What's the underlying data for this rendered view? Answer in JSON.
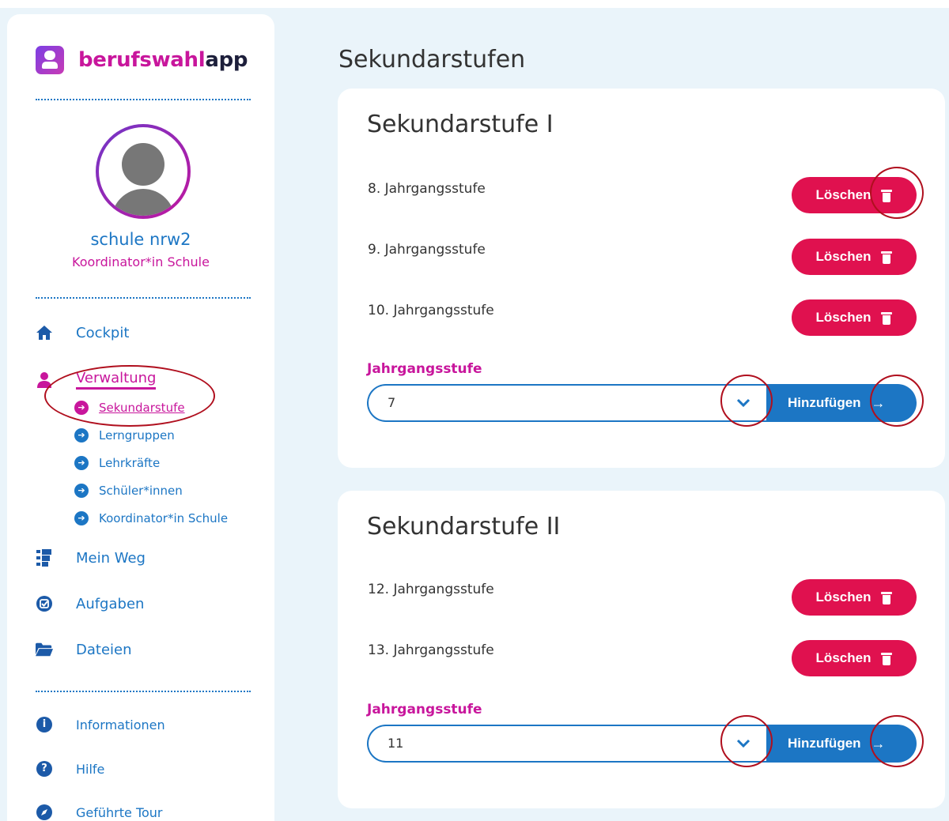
{
  "brand": {
    "name_part1": "berufswahl",
    "name_part2": "app"
  },
  "user": {
    "name": "schule nrw2",
    "role": "Koordinator*in Schule"
  },
  "nav": {
    "cockpit": "Cockpit",
    "verwaltung": "Verwaltung",
    "sub": [
      "Sekundarstufe",
      "Lerngruppen",
      "Lehrkräfte",
      "Schüler*innen",
      "Koordinator*in Schule"
    ],
    "mein_weg": "Mein Weg",
    "aufgaben": "Aufgaben",
    "dateien": "Dateien",
    "informationen": "Informationen",
    "hilfe": "Hilfe",
    "tour": "Geführte Tour"
  },
  "page": {
    "title": "Sekundarstufen"
  },
  "sections": [
    {
      "title": "Sekundarstufe I",
      "rows": [
        "8. Jahrgangsstufe",
        "9. Jahrgangsstufe",
        "10. Jahrgangsstufe"
      ],
      "delete_label": "Löschen",
      "field_label": "Jahrgangsstufe",
      "select_value": "7",
      "add_label": "Hinzufügen"
    },
    {
      "title": "Sekundarstufe II",
      "rows": [
        "12. Jahrgangsstufe",
        "13. Jahrgangsstufe"
      ],
      "delete_label": "Löschen",
      "field_label": "Jahrgangsstufe",
      "select_value": "11",
      "add_label": "Hinzufügen"
    }
  ],
  "colors": {
    "primary": "#1c76c4",
    "accent": "#c8169c",
    "danger": "#e0114f",
    "annotation": "#b00f1e"
  },
  "icons": [
    "home-icon",
    "user-icon",
    "arrow-circle-icon",
    "list-icon",
    "check-circle-icon",
    "folder-icon",
    "info-icon",
    "question-icon",
    "compass-icon",
    "trash-icon",
    "chevron-down-icon",
    "arrow-right-icon"
  ]
}
